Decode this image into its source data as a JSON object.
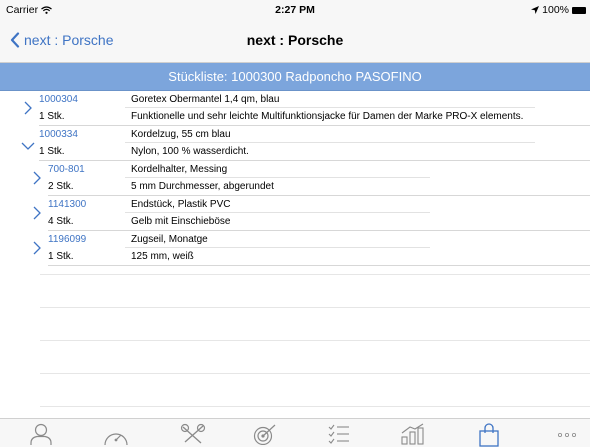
{
  "status_bar": {
    "carrier": "Carrier",
    "time": "2:27 PM",
    "battery": "100%"
  },
  "nav": {
    "back_label": "next : Porsche",
    "title": "next : Porsche"
  },
  "header": {
    "title": "Stückliste: 1000300 Radponcho PASOFINO"
  },
  "items": [
    {
      "number": "1000304",
      "qty": "1 Stk.",
      "name": "Goretex Obermantel 1,4 qm, blau",
      "detail": "Funktionelle und sehr leichte Multifunktionsjacke für Damen der Marke PRO-X elements.",
      "expanded": false,
      "level": 0
    },
    {
      "number": "1000334",
      "qty": "1 Stk.",
      "name": "Kordelzug, 55 cm blau",
      "detail": "Nylon, 100 % wasserdicht.",
      "expanded": true,
      "level": 0
    },
    {
      "number": "700-801",
      "qty": "2 Stk.",
      "name": "Kordelhalter, Messing",
      "detail": "5 mm Durchmesser, abgerundet",
      "expanded": false,
      "level": 1
    },
    {
      "number": "1141300",
      "qty": "4 Stk.",
      "name": "Endstück, Plastik PVC",
      "detail": "Gelb mit Einschieböse",
      "expanded": false,
      "level": 1
    },
    {
      "number": "1196099",
      "qty": "1 Stk.",
      "name": "Zugseil, Monatge",
      "detail": "125 mm, weiß",
      "expanded": false,
      "level": 1
    }
  ],
  "tabs": [
    {
      "icon": "person-icon"
    },
    {
      "icon": "speedometer-icon"
    },
    {
      "icon": "tools-icon"
    },
    {
      "icon": "target-icon"
    },
    {
      "icon": "checklist-icon"
    },
    {
      "icon": "chart-icon"
    },
    {
      "icon": "shopping-bag-icon",
      "active": true
    },
    {
      "icon": "more-icon"
    }
  ],
  "colors": {
    "accent": "#3f74c4",
    "header_bg": "#7ca5dc",
    "active_tab": "#3f74c4",
    "inactive_tab": "#8a8a8a"
  }
}
